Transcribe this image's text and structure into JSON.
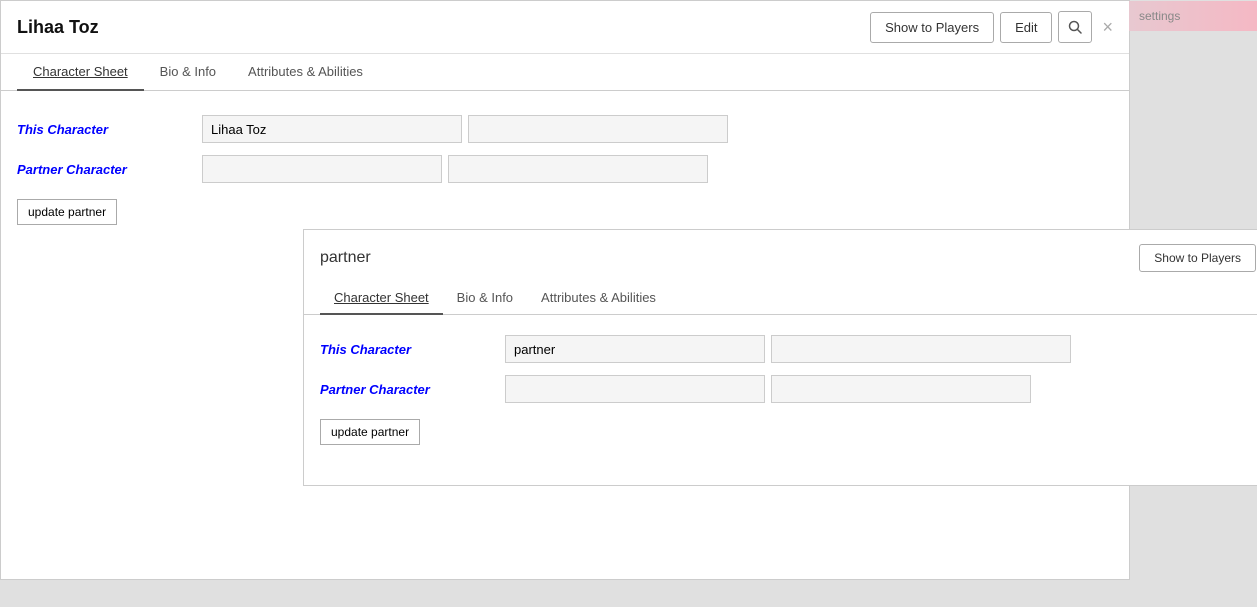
{
  "header": {
    "title": "Lihaa Toz",
    "show_players_label": "Show to Players",
    "edit_label": "Edit",
    "close_label": "×",
    "settings_text": "settings"
  },
  "tabs": {
    "items": [
      {
        "label": "Character Sheet",
        "active": true
      },
      {
        "label": "Bio & Info",
        "active": false
      },
      {
        "label": "Attributes & Abilities",
        "active": false
      }
    ]
  },
  "fields": {
    "this_character_label": "This Character",
    "partner_character_label": "Partner Character",
    "this_character_value": "Lihaa Toz",
    "this_character_secondary": "",
    "partner_value1": "",
    "partner_value2": "",
    "update_partner_label": "update partner"
  },
  "partner_panel": {
    "title": "partner",
    "show_players_label": "Show to Players",
    "tabs": [
      {
        "label": "Character Sheet",
        "active": true
      },
      {
        "label": "Bio & Info",
        "active": false
      },
      {
        "label": "Attributes & Abilities",
        "active": false
      }
    ],
    "this_character_label": "This Character",
    "partner_character_label": "Partner Character",
    "this_character_value": "partner",
    "this_character_secondary": "",
    "partner_value1": "",
    "partner_value2": "",
    "update_partner_label": "update partner"
  }
}
